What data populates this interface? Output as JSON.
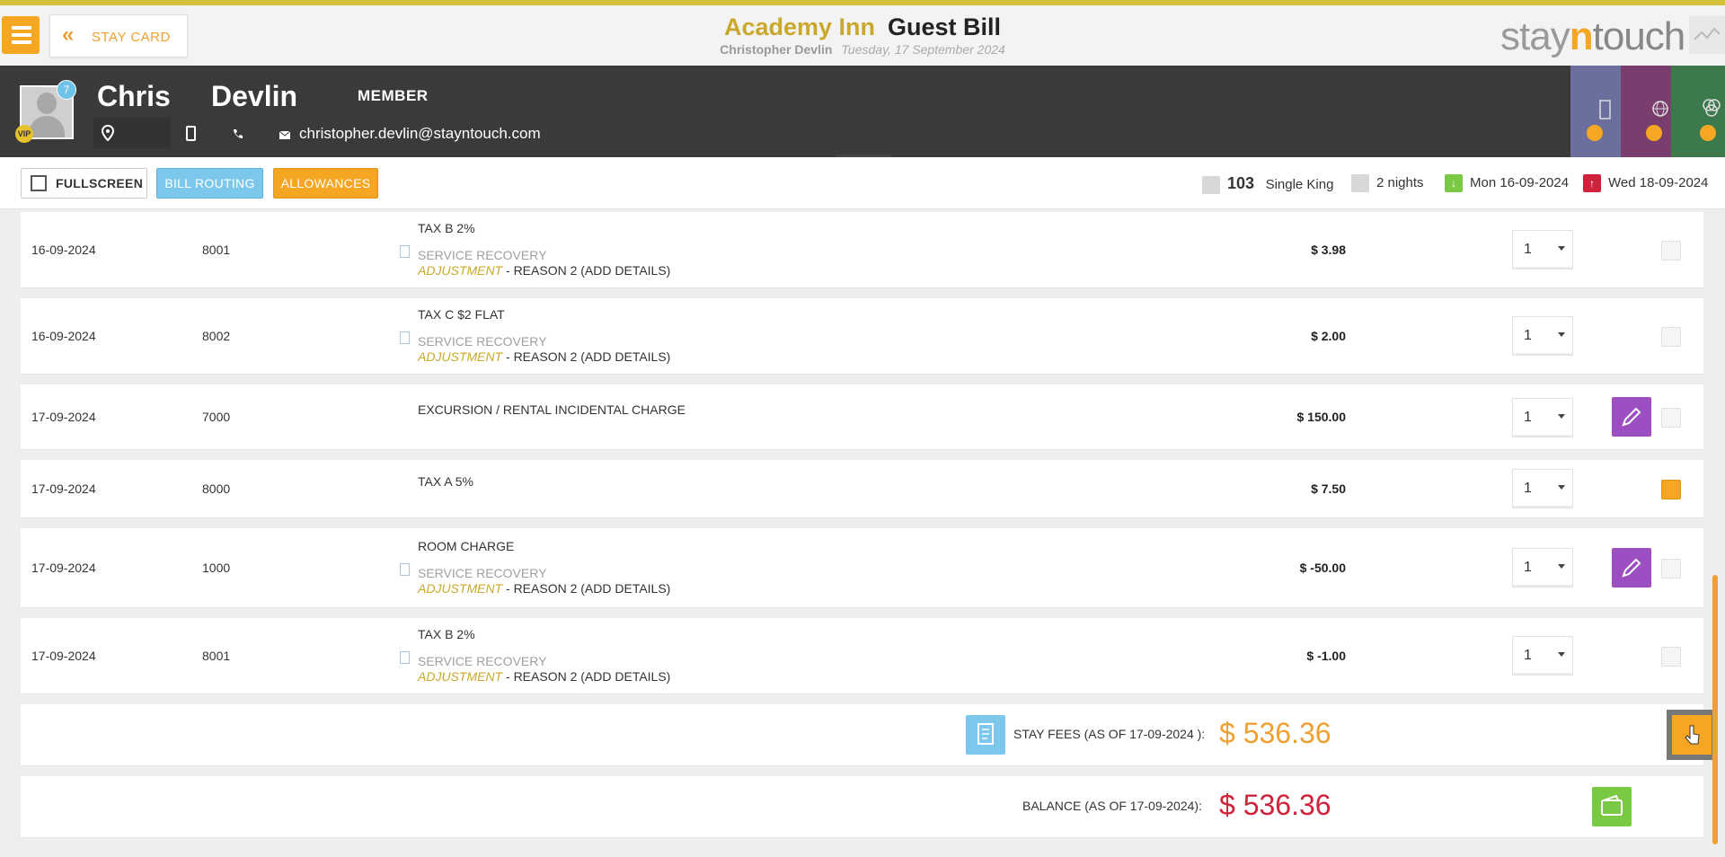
{
  "header": {
    "stay_card_label": "STAY CARD",
    "hotel_name": "Academy Inn",
    "page_title": "Guest Bill",
    "guest_full_name": "Christopher Devlin",
    "date": "Tuesday, 17 September 2024",
    "brand": {
      "prefix": "stay",
      "accent": "n",
      "suffix": "touch"
    }
  },
  "guest": {
    "first_name": "Chris",
    "last_name": "Devlin",
    "membership": "MEMBER",
    "badge_count": "7",
    "vip_label": "VIP",
    "email": "christopher.devlin@stayntouch.com"
  },
  "actions": {
    "fullscreen_label": "FULLSCREEN",
    "bill_routing_label": "BILL ROUTING",
    "allowances_label": "ALLOWANCES"
  },
  "stay": {
    "room_number": "103",
    "room_type": "Single King",
    "nights": "2 nights",
    "arrival": "Mon 16-09-2024",
    "departure": "Wed 18-09-2024"
  },
  "transactions": [
    {
      "date": "16-09-2024",
      "code": "8001",
      "description": "TAX B 2%",
      "service": "SERVICE RECOVERY",
      "adjustment": "ADJUSTMENT",
      "reason": " - REASON 2 (ADD DETAILS)",
      "amount": "$ 3.98",
      "qty": "1",
      "selected": false
    },
    {
      "date": "16-09-2024",
      "code": "8002",
      "description": "TAX C $2 FLAT",
      "service": "SERVICE RECOVERY",
      "adjustment": "ADJUSTMENT",
      "reason": " - REASON 2 (ADD DETAILS)",
      "amount": "$ 2.00",
      "qty": "1",
      "selected": false
    },
    {
      "date": "17-09-2024",
      "code": "7000",
      "description": "EXCURSION / RENTAL INCIDENTAL CHARGE",
      "amount": "$ 150.00",
      "qty": "1",
      "selected": false
    },
    {
      "date": "17-09-2024",
      "code": "8000",
      "description": "TAX A 5%",
      "amount": "$ 7.50",
      "qty": "1",
      "selected": true
    },
    {
      "date": "17-09-2024",
      "code": "1000",
      "description": "ROOM CHARGE",
      "service": "SERVICE RECOVERY",
      "adjustment": "ADJUSTMENT",
      "reason": " - REASON 2 (ADD DETAILS)",
      "amount": "$ -50.00",
      "qty": "1",
      "selected": false
    },
    {
      "date": "17-09-2024",
      "code": "8001",
      "description": "TAX B 2%",
      "service": "SERVICE RECOVERY",
      "adjustment": "ADJUSTMENT",
      "reason": " - REASON 2 (ADD DETAILS)",
      "amount": "$ -1.00",
      "qty": "1",
      "selected": false
    }
  ],
  "totals": {
    "stay_fees_label": "STAY FEES (AS OF  17-09-2024 ):",
    "stay_fees_amount": "$ 536.36",
    "balance_label": "BALANCE (AS OF  17-09-2024):",
    "balance_amount": "$ 536.36"
  },
  "colors": {
    "accent_orange": "#f5a623",
    "gold": "#c9a82b",
    "balance_red": "#d0223a",
    "edit_purple": "#9b4fc0",
    "routing_blue": "#7cc8ec",
    "wallet_green": "#7ac943"
  }
}
